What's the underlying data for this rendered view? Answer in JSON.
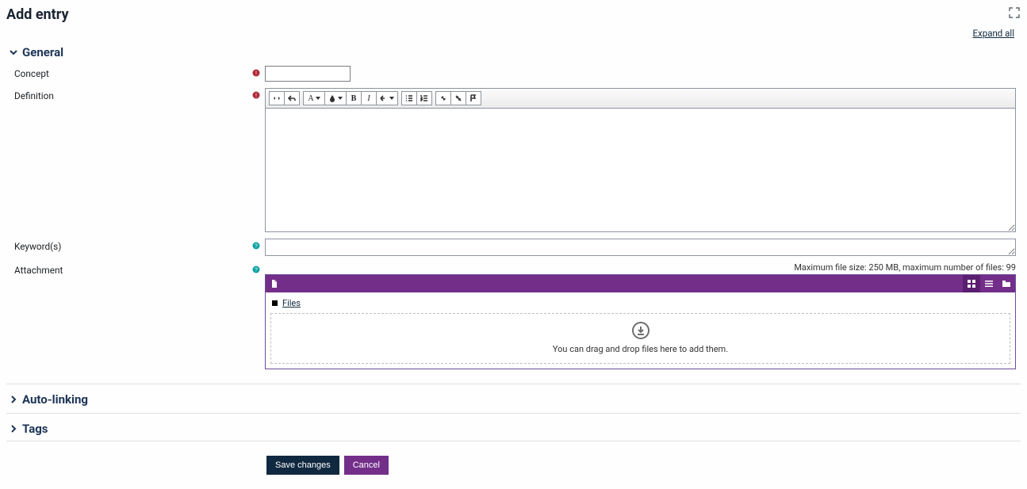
{
  "page": {
    "title": "Add entry",
    "expand_all": "Expand all"
  },
  "sections": {
    "general": {
      "title": "General",
      "expanded": true
    },
    "autolinking": {
      "title": "Auto-linking",
      "expanded": false
    },
    "tags": {
      "title": "Tags",
      "expanded": false
    }
  },
  "fields": {
    "concept": {
      "label": "Concept",
      "required": true,
      "value": ""
    },
    "definition": {
      "label": "Definition",
      "required": true,
      "value": ""
    },
    "keywords": {
      "label": "Keyword(s)",
      "help": true,
      "value": ""
    },
    "attachment": {
      "label": "Attachment",
      "help": true,
      "info": "Maximum file size: 250 MB, maximum number of files: 99",
      "breadcrumb": "Files",
      "dropzone_text": "You can drag and drop files here to add them."
    }
  },
  "editor_toolbar": {
    "font_label": "A",
    "bold": "B",
    "italic": "I"
  },
  "actions": {
    "save": "Save changes",
    "cancel": "Cancel"
  }
}
